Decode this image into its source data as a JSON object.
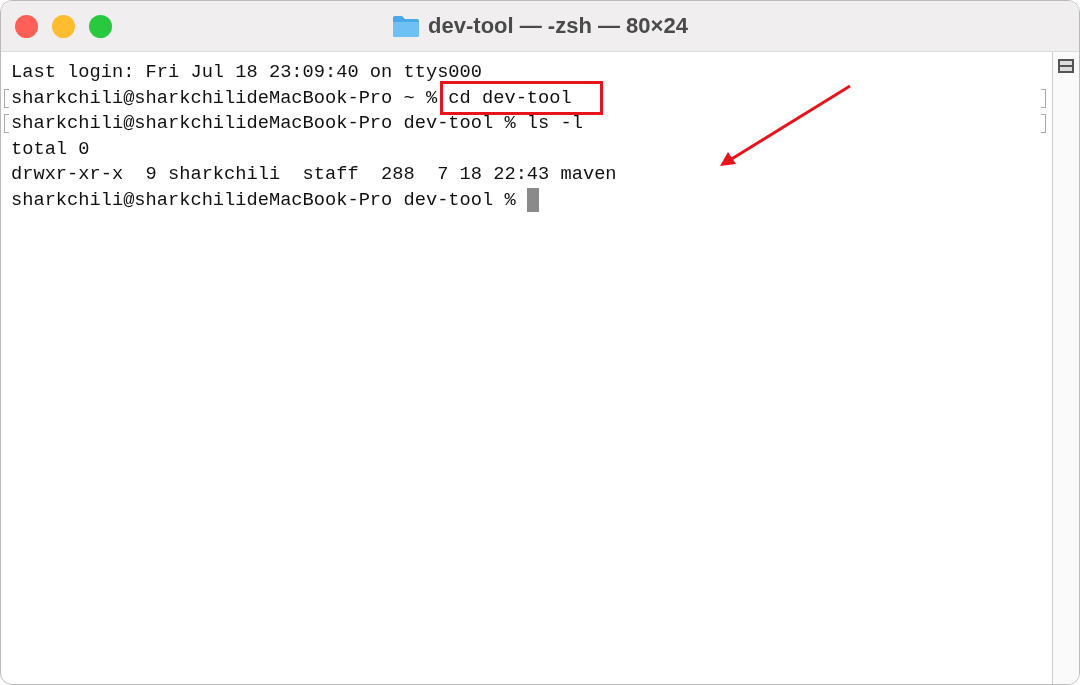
{
  "window": {
    "title": "dev-tool — -zsh — 80×24"
  },
  "terminal": {
    "lines": [
      {
        "prompt": "Last login: Fri Jul 18 23:09:40 on ttys000",
        "marked": false
      },
      {
        "prompt": "sharkchili@sharkchilideMacBook-Pro ~ % ",
        "command": "cd dev-tool",
        "boxed": true,
        "marked": true
      },
      {
        "prompt": "sharkchili@sharkchilideMacBook-Pro dev-tool % ls -l",
        "marked": true
      },
      {
        "prompt": "total 0",
        "marked": false
      },
      {
        "prompt": "drwxr-xr-x  9 sharkchili  staff  288  7 18 22:43 maven",
        "marked": false,
        "arrow": true
      },
      {
        "prompt": "sharkchili@sharkchilideMacBook-Pro dev-tool % ",
        "cursor": true,
        "marked": false
      }
    ]
  }
}
